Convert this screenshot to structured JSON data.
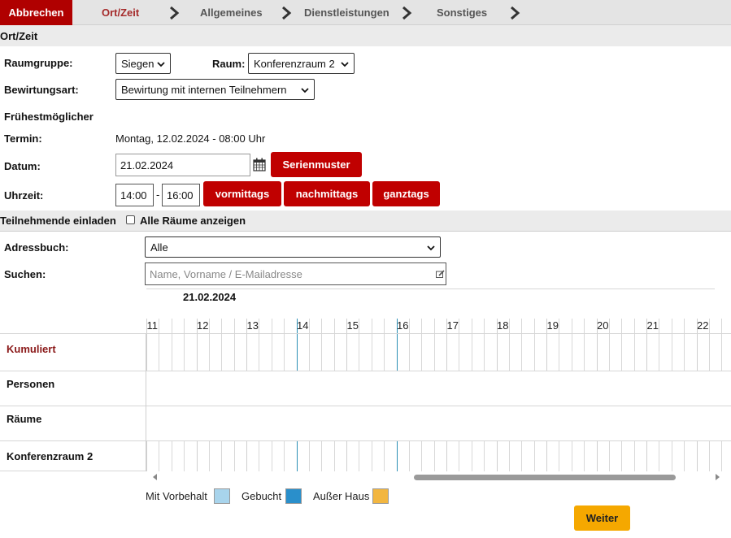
{
  "wizard": {
    "abort_label": "Abbrechen",
    "steps": [
      {
        "label": "Ort/Zeit",
        "active": true
      },
      {
        "label": "Allgemeines",
        "active": false
      },
      {
        "label": "Dienstleistungen",
        "active": false
      },
      {
        "label": "Sonstiges",
        "active": false
      }
    ]
  },
  "ort_zeit": {
    "section_title": "Ort/Zeit",
    "raumgruppe_label": "Raumgruppe:",
    "raumgruppe_value": "Siegen",
    "raum_label": "Raum:",
    "raum_value": "Konferenzraum 2",
    "bewirtung_label": "Bewirtungsart:",
    "bewirtung_value": "Bewirtung mit internen Teilnehmern",
    "fruehest_label_1": "Frühestmöglicher",
    "fruehest_label_2": "Termin:",
    "fruehest_value": "Montag, 12.02.2024 - 08:00 Uhr",
    "datum_label": "Datum:",
    "datum_value": "21.02.2024",
    "serienmuster_label": "Serienmuster",
    "uhrzeit_label": "Uhrzeit:",
    "time_from": "14:00",
    "time_sep": "-",
    "time_to": "16:00",
    "vormittags_label": "vormittags",
    "nachmittags_label": "nachmittags",
    "ganztags_label": "ganztags"
  },
  "teilnehmende": {
    "section_title": "Teilnehmende einladen",
    "alle_raeume_label": "Alle Räume anzeigen",
    "alle_raeume_checked": false,
    "adressbuch_label": "Adressbuch:",
    "adressbuch_value": "Alle",
    "suchen_label": "Suchen:",
    "suchen_placeholder": "Name, Vorname / E-Mailadresse"
  },
  "timeline": {
    "date": "21.02.2024",
    "hours": [
      "11",
      "12",
      "13",
      "14",
      "15",
      "16",
      "17",
      "18",
      "19",
      "20",
      "21",
      "22"
    ],
    "selection_start": "14:00",
    "selection_end": "16:00",
    "rows": [
      {
        "label": "Kumuliert",
        "color": "#8b1a1a"
      },
      {
        "label": "Personen",
        "color": "#111111"
      },
      {
        "label": "Räume",
        "color": "#111111"
      },
      {
        "label": "Konferenzraum 2",
        "color": "#111111"
      }
    ]
  },
  "legend": [
    {
      "label": "Mit Vorbehalt",
      "color": "#a8d4ec"
    },
    {
      "label": "Gebucht",
      "color": "#2a8fcb"
    },
    {
      "label": "Außer Haus",
      "color": "#f2b640"
    }
  ],
  "actions": {
    "weiter_label": "Weiter"
  },
  "colors": {
    "brand_red": "#c00000",
    "accent_orange": "#f5a800",
    "active_step": "#a52a2a"
  }
}
